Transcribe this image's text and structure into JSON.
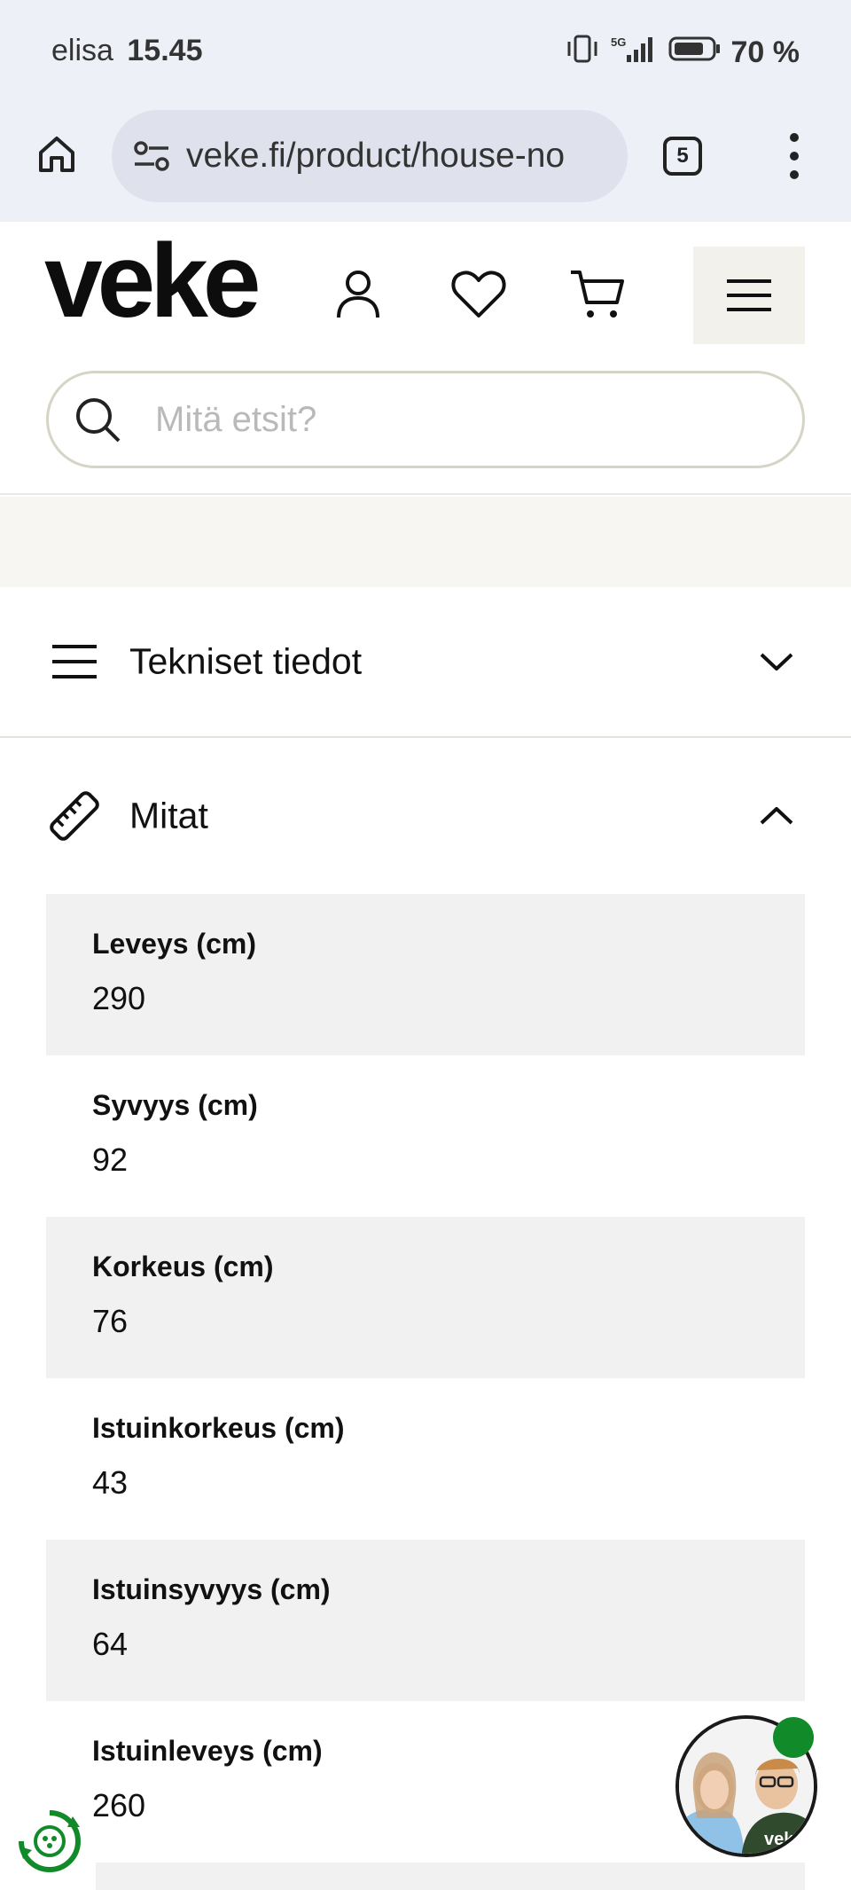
{
  "status_bar": {
    "carrier": "elisa",
    "time": "15.45",
    "battery": "70 %",
    "network": "5G"
  },
  "browser": {
    "url": "veke.fi/product/house-no",
    "tab_count": "5"
  },
  "header": {
    "logo": "veke",
    "search_placeholder": "Mitä etsit?"
  },
  "sections": {
    "tech": "Tekniset tiedot",
    "dimensions": "Mitat"
  },
  "specs": [
    {
      "label": "Leveys (cm)",
      "value": "290"
    },
    {
      "label": "Syvyys (cm)",
      "value": "92"
    },
    {
      "label": "Korkeus (cm)",
      "value": "76"
    },
    {
      "label": "Istuinkorkeus (cm)",
      "value": "43"
    },
    {
      "label": "Istuinsyvyys (cm)",
      "value": "64"
    },
    {
      "label": "Istuinleveys (cm)",
      "value": "260"
    }
  ],
  "colors": {
    "accent_green": "#118a2a",
    "row_shade": "#f1f1f1",
    "browser_bg": "#eef0f8"
  }
}
